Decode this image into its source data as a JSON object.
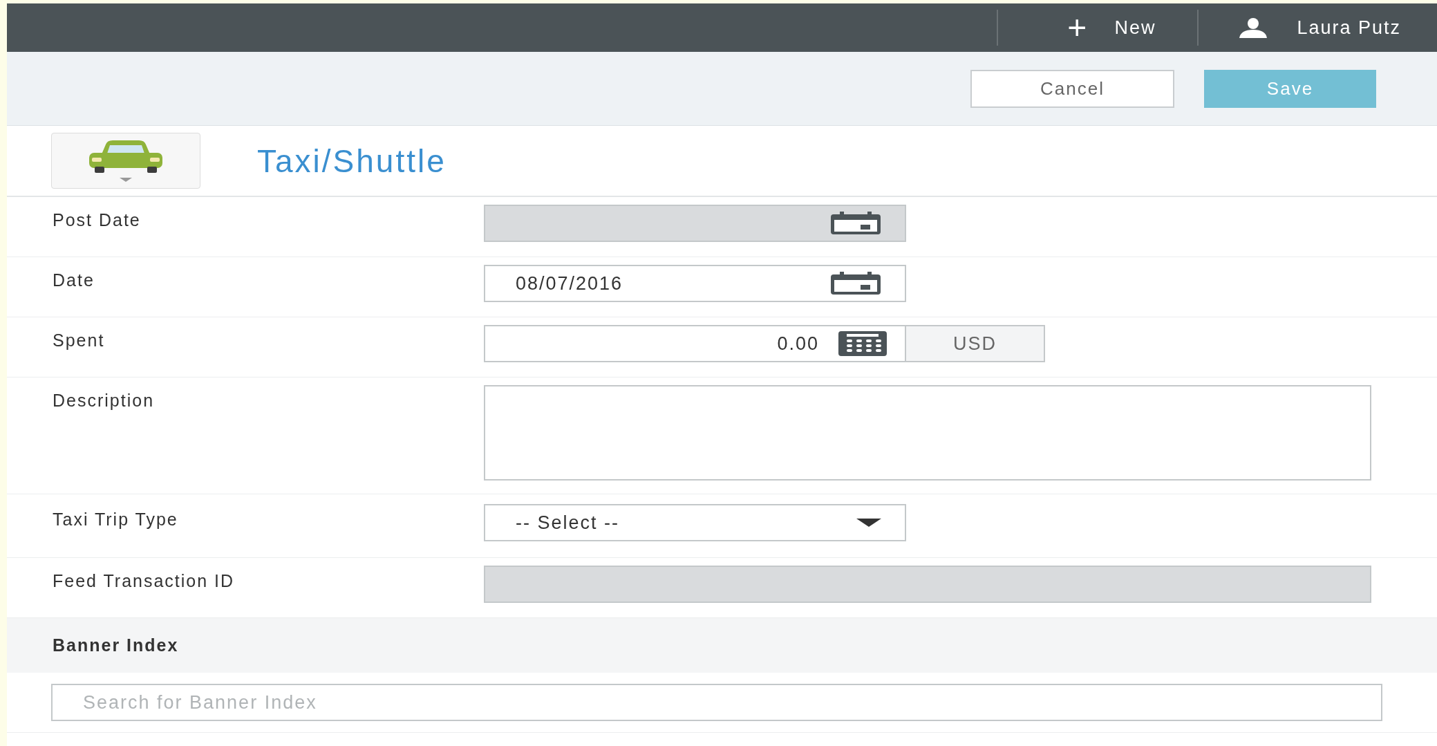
{
  "top_bar": {
    "new_button": {
      "icon": "+",
      "label": "New"
    },
    "user": "Laura Putz"
  },
  "actions": {
    "cancel": "Cancel",
    "save": "Save"
  },
  "header": {
    "title": "Taxi/Shuttle"
  },
  "fields": [
    {
      "kind": "date",
      "label": "Post Date",
      "disabled": true
    },
    {
      "kind": "date",
      "label": "Date",
      "value": "08/07/2016",
      "disabled": false
    },
    {
      "kind": "amount",
      "label": "Spent",
      "value": "0.00",
      "currency": "USD",
      "disabled": false
    },
    {
      "kind": "textarea",
      "label": "Description",
      "disabled": false
    },
    {
      "kind": "select",
      "label": "Taxi Trip Type",
      "value": "-- Select --",
      "disabled": false
    },
    {
      "kind": "text",
      "label": "Feed Transaction ID",
      "disabled": true
    }
  ],
  "banner": {
    "title": "Banner Index",
    "search": {
      "placeholder": "Search for Banner Index"
    }
  }
}
